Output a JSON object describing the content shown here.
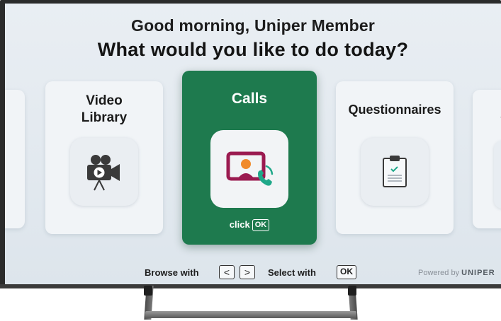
{
  "screen": {
    "greeting": "Good morning, Uniper Member",
    "question": "What would you like to do today?"
  },
  "cards": {
    "partial_right_char": "S",
    "video": {
      "title_line1": "Video",
      "title_line2": "Library",
      "icon": "video-camera-icon"
    },
    "calls": {
      "title": "Calls",
      "icon": "video-call-icon",
      "hint": "click",
      "hint_key": "OK",
      "selected": true
    },
    "questionnaires": {
      "title": "Questionnaires",
      "icon": "clipboard-icon"
    }
  },
  "footer": {
    "browse_label": "Browse with",
    "left_key": "<",
    "right_key": ">",
    "select_label": "Select with",
    "ok_key": "OK",
    "powered_by": "Powered by",
    "brand": "UNIPER"
  },
  "colors": {
    "selected_card": "#1e7a4e",
    "screen_bg": "#e4ebf1",
    "call_icon_maroon": "#9b1b50",
    "call_icon_orange": "#f08a2b",
    "call_icon_teal": "#1fa889"
  }
}
